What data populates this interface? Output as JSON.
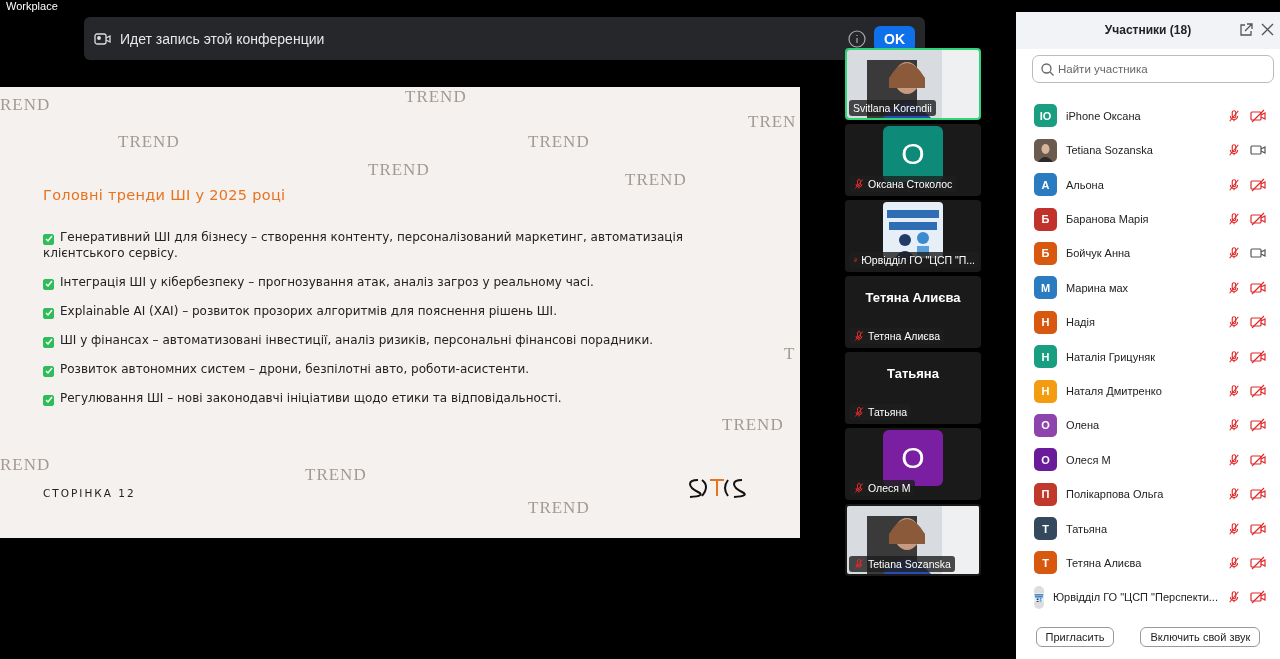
{
  "app": {
    "title": "Workplace"
  },
  "notice": {
    "text": "Идет запись этой конференции",
    "button": "OK"
  },
  "slide": {
    "title": "Головні тренди ШІ у 2025 році",
    "bullets": [
      {
        "text": "Генеративний ШІ для бізнесу – створення контенту, персоналізований маркетинг, автоматизація клієнтського сервісу.",
        "checked": true
      },
      {
        "text": "Інтеграція ШІ у кібербезпеку – прогнозування атак, аналіз загроз у реальному часі.",
        "checked": true
      },
      {
        "text": "Explainable AI (XAI) – розвиток прозорих алгоритмів для пояснення рішень ШІ.",
        "checked": true
      },
      {
        "text": "ШІ у фінансах – автоматизовані інвестиції, аналіз ризиків, персональні фінансові порадники.",
        "checked": true
      },
      {
        "text": "Розвиток автономних систем – дрони, безпілотні авто, роботи-асистенти.",
        "checked": true
      },
      {
        "text": "Регулювання ШІ – нові законодавчі ініціативи щодо етики та відповідальності.",
        "checked": true
      }
    ],
    "page": "СТОРІНКА 12",
    "watermarks": [
      "REND",
      "TREND",
      "TREND",
      "TREND",
      "TREN",
      "TREND",
      "TREND",
      "T",
      "REND",
      "TREND",
      "TREND",
      "TREND"
    ]
  },
  "video_tiles": [
    {
      "kind": "video",
      "name": "Svitlana Korendii",
      "muted": false,
      "active": true
    },
    {
      "kind": "avatar",
      "letter": "О",
      "color": "#0e8a78",
      "name": "Оксана Стоколос",
      "muted": true,
      "active": false
    },
    {
      "kind": "logo",
      "name": "Юрвідділ ГО \"ЦСП \"П...",
      "muted": true,
      "active": false
    },
    {
      "kind": "name",
      "display": "Тетяна Алиєва",
      "name": "Тетяна Алиєва",
      "muted": true,
      "active": false
    },
    {
      "kind": "name",
      "display": "Татьяна",
      "name": "Татьяна",
      "muted": true,
      "active": false
    },
    {
      "kind": "avatar",
      "letter": "О",
      "color": "#7b1fa2",
      "name": "Олеся М",
      "muted": true,
      "active": false
    },
    {
      "kind": "video",
      "name": "Tetiana Sozanska",
      "muted": true,
      "active": false
    }
  ],
  "participants_panel": {
    "title": "Участники (18)",
    "search": {
      "placeholder": "Найти участника"
    },
    "participants": [
      {
        "kind": "letter",
        "initials": "IO",
        "color": "#1a9e82",
        "name": "iPhone Оксана",
        "muted": true,
        "video_on": false
      },
      {
        "name": "Tetiana Sozanska",
        "muted": true,
        "video_on": true
      },
      {
        "kind": "letter",
        "initials": "А",
        "color": "#2b7bc0",
        "name": "Альона",
        "muted": true,
        "video_on": false
      },
      {
        "kind": "letter",
        "initials": "Б",
        "color": "#c2322c",
        "name": "Баранова Марія",
        "muted": true,
        "video_on": false
      },
      {
        "kind": "letter",
        "initials": "Б",
        "color": "#d9580f",
        "name": "Бойчук Анна",
        "muted": true,
        "video_on": true
      },
      {
        "kind": "letter",
        "initials": "М",
        "color": "#2b7bc0",
        "name": "Марина мах",
        "muted": true,
        "video_on": false
      },
      {
        "kind": "letter",
        "initials": "Н",
        "color": "#d9580f",
        "name": "Надія",
        "muted": true,
        "video_on": false
      },
      {
        "kind": "letter",
        "initials": "Н",
        "color": "#1a9e82",
        "name": "Наталія Грицуняк",
        "muted": true,
        "video_on": false
      },
      {
        "kind": "letter",
        "initials": "Н",
        "color": "#f39c12",
        "name": "Наталя Дмитренко",
        "muted": true,
        "video_on": false
      },
      {
        "kind": "letter",
        "initials": "О",
        "color": "#8e44ad",
        "name": "Олена",
        "muted": true,
        "video_on": false
      },
      {
        "kind": "letter",
        "initials": "О",
        "color": "#6a1b9a",
        "name": "Олеся М",
        "muted": true,
        "video_on": false
      },
      {
        "kind": "letter",
        "initials": "П",
        "color": "#c0392b",
        "name": "Полікарпова Ольга",
        "muted": true,
        "video_on": false
      },
      {
        "kind": "letter",
        "initials": "Т",
        "color": "#34495e",
        "name": "Татьяна",
        "muted": true,
        "video_on": false
      },
      {
        "kind": "letter",
        "initials": "Т",
        "color": "#d9580f",
        "name": "Тетяна Алиєва",
        "muted": true,
        "video_on": false
      },
      {
        "kind": "logo",
        "name": "Юрвідділ ГО  \"ЦСП \"Перспекти...",
        "muted": true,
        "video_on": false
      }
    ],
    "buttons": [
      "Пригласить",
      "Включить свой звук"
    ]
  }
}
